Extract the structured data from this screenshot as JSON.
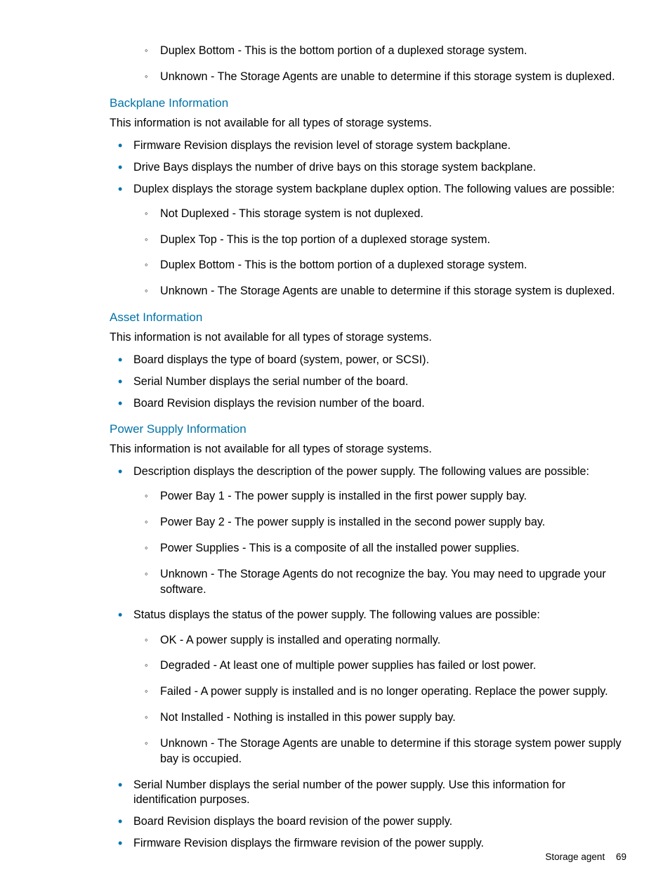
{
  "intro_sub": [
    "Duplex Bottom - This is the bottom portion of a duplexed storage system.",
    "Unknown - The Storage Agents are unable to determine if this storage system is duplexed."
  ],
  "sections": {
    "backplane": {
      "heading": "Backplane Information",
      "para": "This information is not available for all types of storage systems.",
      "items": [
        {
          "text": "Firmware Revision displays the revision level of storage system backplane."
        },
        {
          "text": "Drive Bays displays the number of drive bays on this storage system backplane."
        },
        {
          "text": "Duplex displays the storage system backplane duplex option. The following values are possible:",
          "sub": [
            "Not Duplexed - This storage system is not duplexed.",
            "Duplex Top - This is the top portion of a duplexed storage system.",
            "Duplex Bottom - This is the bottom portion of a duplexed storage system.",
            "Unknown - The Storage Agents are unable to determine if this storage system is duplexed."
          ]
        }
      ]
    },
    "asset": {
      "heading": "Asset Information",
      "para": "This information is not available for all types of storage systems.",
      "items": [
        {
          "text": "Board displays the type of board (system, power, or SCSI)."
        },
        {
          "text": "Serial Number displays the serial number of the board."
        },
        {
          "text": "Board Revision displays the revision number of the board."
        }
      ]
    },
    "power": {
      "heading": "Power Supply Information",
      "para": "This information is not available for all types of storage systems.",
      "items": [
        {
          "text": "Description displays the description of the power supply. The following values are possible:",
          "sub": [
            "Power Bay 1 - The power supply is installed in the first power supply bay.",
            "Power Bay 2 - The power supply is installed in the second power supply bay.",
            "Power Supplies - This is a composite of all the installed power supplies.",
            "Unknown - The Storage Agents do not recognize the bay. You may need to upgrade your software."
          ]
        },
        {
          "text": "Status displays the status of the power supply. The following values are possible:",
          "sub": [
            "OK - A power supply is installed and operating normally.",
            "Degraded - At least one of multiple power supplies has failed or lost power.",
            "Failed - A power supply is installed and is no longer operating. Replace the power supply.",
            "Not Installed - Nothing is installed in this power supply bay.",
            "Unknown - The Storage Agents are unable to determine if this storage system power supply bay is occupied."
          ]
        },
        {
          "text": "Serial Number displays the serial number of the power supply. Use this information for identification purposes."
        },
        {
          "text": "Board Revision displays the board revision of the power supply."
        },
        {
          "text": "Firmware Revision displays the firmware revision of the power supply."
        }
      ]
    }
  },
  "footer": {
    "section": "Storage agent",
    "page": "69"
  }
}
